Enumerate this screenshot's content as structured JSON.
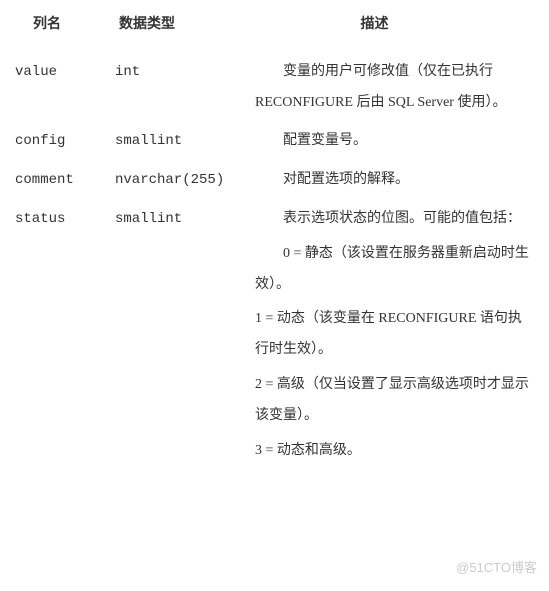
{
  "headers": {
    "col1": "列名",
    "col2": "数据类型",
    "col3": "描述"
  },
  "rows": [
    {
      "name": "value",
      "type": "int",
      "desc": "变量的用户可修改值（仅在已执行 RECONFIGURE 后由 SQL Server 使用）。"
    },
    {
      "name": "config",
      "type": "smallint",
      "desc": "配置变量号。"
    },
    {
      "name": "comment",
      "type": "nvarchar(255)",
      "desc": "对配置选项的解释。"
    },
    {
      "name": "status",
      "type": "smallint",
      "desc": "表示选项状态的位图。可能的值包括："
    }
  ],
  "status_details": [
    "0 = 静态（该设置在服务器重新启动时生效）。",
    "1 = 动态（该变量在 RECONFIGURE 语句执行时生效）。",
    "2 = 高级（仅当设置了显示高级选项时才显示该变量）。",
    "3 = 动态和高级。"
  ],
  "watermark": "@51CTO博客"
}
